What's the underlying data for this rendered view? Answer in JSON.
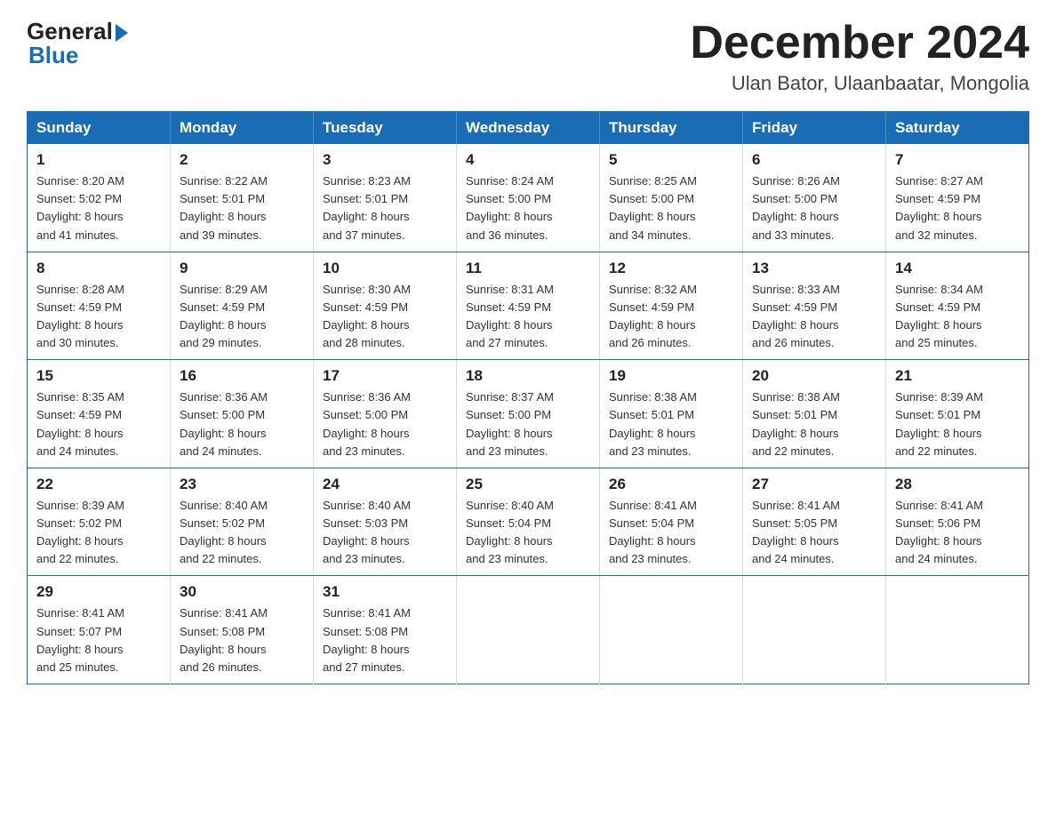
{
  "logo": {
    "general": "General",
    "blue": "Blue"
  },
  "header": {
    "title": "December 2024",
    "subtitle": "Ulan Bator, Ulaanbaatar, Mongolia"
  },
  "weekdays": [
    "Sunday",
    "Monday",
    "Tuesday",
    "Wednesday",
    "Thursday",
    "Friday",
    "Saturday"
  ],
  "weeks": [
    [
      {
        "day": "1",
        "sunrise": "8:20 AM",
        "sunset": "5:02 PM",
        "daylight": "8 hours and 41 minutes."
      },
      {
        "day": "2",
        "sunrise": "8:22 AM",
        "sunset": "5:01 PM",
        "daylight": "8 hours and 39 minutes."
      },
      {
        "day": "3",
        "sunrise": "8:23 AM",
        "sunset": "5:01 PM",
        "daylight": "8 hours and 37 minutes."
      },
      {
        "day": "4",
        "sunrise": "8:24 AM",
        "sunset": "5:00 PM",
        "daylight": "8 hours and 36 minutes."
      },
      {
        "day": "5",
        "sunrise": "8:25 AM",
        "sunset": "5:00 PM",
        "daylight": "8 hours and 34 minutes."
      },
      {
        "day": "6",
        "sunrise": "8:26 AM",
        "sunset": "5:00 PM",
        "daylight": "8 hours and 33 minutes."
      },
      {
        "day": "7",
        "sunrise": "8:27 AM",
        "sunset": "4:59 PM",
        "daylight": "8 hours and 32 minutes."
      }
    ],
    [
      {
        "day": "8",
        "sunrise": "8:28 AM",
        "sunset": "4:59 PM",
        "daylight": "8 hours and 30 minutes."
      },
      {
        "day": "9",
        "sunrise": "8:29 AM",
        "sunset": "4:59 PM",
        "daylight": "8 hours and 29 minutes."
      },
      {
        "day": "10",
        "sunrise": "8:30 AM",
        "sunset": "4:59 PM",
        "daylight": "8 hours and 28 minutes."
      },
      {
        "day": "11",
        "sunrise": "8:31 AM",
        "sunset": "4:59 PM",
        "daylight": "8 hours and 27 minutes."
      },
      {
        "day": "12",
        "sunrise": "8:32 AM",
        "sunset": "4:59 PM",
        "daylight": "8 hours and 26 minutes."
      },
      {
        "day": "13",
        "sunrise": "8:33 AM",
        "sunset": "4:59 PM",
        "daylight": "8 hours and 26 minutes."
      },
      {
        "day": "14",
        "sunrise": "8:34 AM",
        "sunset": "4:59 PM",
        "daylight": "8 hours and 25 minutes."
      }
    ],
    [
      {
        "day": "15",
        "sunrise": "8:35 AM",
        "sunset": "4:59 PM",
        "daylight": "8 hours and 24 minutes."
      },
      {
        "day": "16",
        "sunrise": "8:36 AM",
        "sunset": "5:00 PM",
        "daylight": "8 hours and 24 minutes."
      },
      {
        "day": "17",
        "sunrise": "8:36 AM",
        "sunset": "5:00 PM",
        "daylight": "8 hours and 23 minutes."
      },
      {
        "day": "18",
        "sunrise": "8:37 AM",
        "sunset": "5:00 PM",
        "daylight": "8 hours and 23 minutes."
      },
      {
        "day": "19",
        "sunrise": "8:38 AM",
        "sunset": "5:01 PM",
        "daylight": "8 hours and 23 minutes."
      },
      {
        "day": "20",
        "sunrise": "8:38 AM",
        "sunset": "5:01 PM",
        "daylight": "8 hours and 22 minutes."
      },
      {
        "day": "21",
        "sunrise": "8:39 AM",
        "sunset": "5:01 PM",
        "daylight": "8 hours and 22 minutes."
      }
    ],
    [
      {
        "day": "22",
        "sunrise": "8:39 AM",
        "sunset": "5:02 PM",
        "daylight": "8 hours and 22 minutes."
      },
      {
        "day": "23",
        "sunrise": "8:40 AM",
        "sunset": "5:02 PM",
        "daylight": "8 hours and 22 minutes."
      },
      {
        "day": "24",
        "sunrise": "8:40 AM",
        "sunset": "5:03 PM",
        "daylight": "8 hours and 23 minutes."
      },
      {
        "day": "25",
        "sunrise": "8:40 AM",
        "sunset": "5:04 PM",
        "daylight": "8 hours and 23 minutes."
      },
      {
        "day": "26",
        "sunrise": "8:41 AM",
        "sunset": "5:04 PM",
        "daylight": "8 hours and 23 minutes."
      },
      {
        "day": "27",
        "sunrise": "8:41 AM",
        "sunset": "5:05 PM",
        "daylight": "8 hours and 24 minutes."
      },
      {
        "day": "28",
        "sunrise": "8:41 AM",
        "sunset": "5:06 PM",
        "daylight": "8 hours and 24 minutes."
      }
    ],
    [
      {
        "day": "29",
        "sunrise": "8:41 AM",
        "sunset": "5:07 PM",
        "daylight": "8 hours and 25 minutes."
      },
      {
        "day": "30",
        "sunrise": "8:41 AM",
        "sunset": "5:08 PM",
        "daylight": "8 hours and 26 minutes."
      },
      {
        "day": "31",
        "sunrise": "8:41 AM",
        "sunset": "5:08 PM",
        "daylight": "8 hours and 27 minutes."
      },
      null,
      null,
      null,
      null
    ]
  ],
  "labels": {
    "sunrise": "Sunrise:",
    "sunset": "Sunset:",
    "daylight": "Daylight:"
  }
}
